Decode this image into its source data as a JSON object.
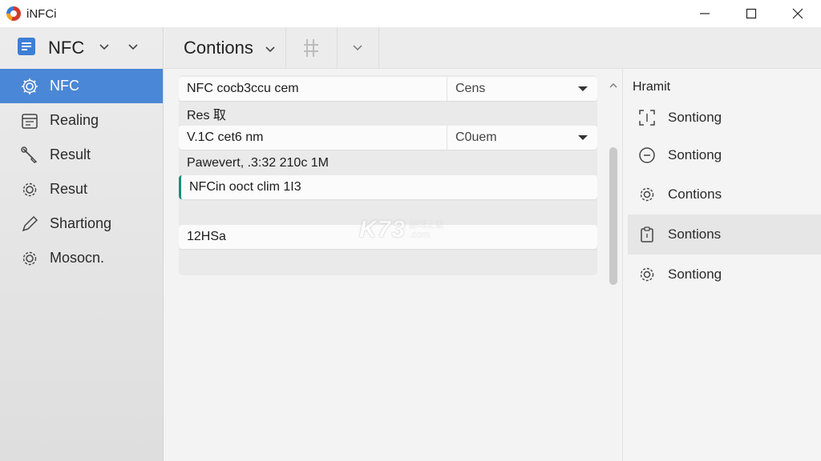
{
  "window": {
    "title": "iNFCi",
    "minimize_icon": "minimize-icon",
    "maximize_icon": "maximize-icon",
    "close_icon": "close-icon"
  },
  "sidebar": {
    "header_label": "NFC",
    "header_icon": "document-icon",
    "items": [
      {
        "label": "NFC",
        "icon": "gear-icon",
        "active": true
      },
      {
        "label": "Realing",
        "icon": "calendar-icon",
        "active": false
      },
      {
        "label": "Result",
        "icon": "wrench-icon",
        "active": false
      },
      {
        "label": "Resut",
        "icon": "gear-icon",
        "active": false
      },
      {
        "label": "Shartiong",
        "icon": "pencil-icon",
        "active": false
      },
      {
        "label": "Mosocn.",
        "icon": "gear-icon",
        "active": false
      }
    ]
  },
  "toolbar": {
    "title": "Contions"
  },
  "main": {
    "rows": [
      {
        "left": "NFC cocb3ccu cem",
        "right": "Cens"
      },
      {
        "left": "Res 取"
      },
      {
        "left": "V.1C cet6 nm",
        "right": "C0uem"
      },
      {
        "left": "Pawevert, .3:32 210c 1M"
      },
      {
        "left": "NFCin ooct clim 1I3"
      },
      {
        "left": ""
      },
      {
        "left": "12HSa"
      }
    ]
  },
  "right_panel": {
    "title": "Hramit",
    "items": [
      {
        "label": "Sontiong",
        "icon": "scan-icon"
      },
      {
        "label": "Sontiong",
        "icon": "minus-circle-icon"
      },
      {
        "label": "Contions",
        "icon": "gear-icon"
      },
      {
        "label": "Sontions",
        "icon": "clipboard-icon"
      },
      {
        "label": "Sontiong",
        "icon": "gear-icon"
      }
    ]
  },
  "watermark": {
    "main": "K73",
    "cn": "游戏之家",
    "com": ".com"
  },
  "colors": {
    "accent": "#4a87d6",
    "row_marker": "#1a8f7a"
  }
}
